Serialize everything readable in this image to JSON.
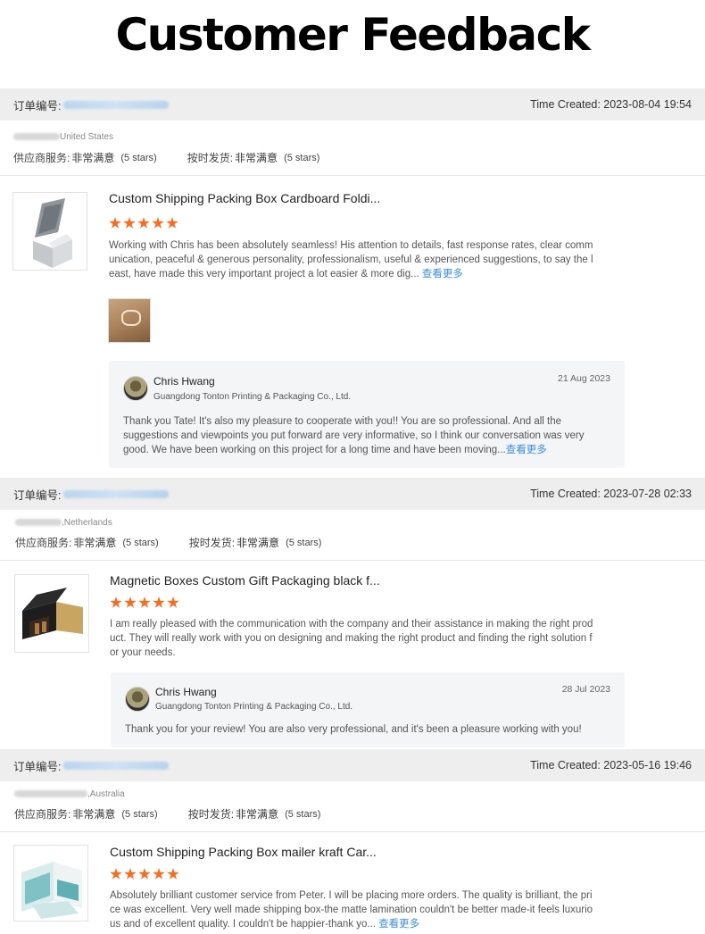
{
  "page": {
    "title": "Customer Feedback"
  },
  "labels": {
    "order_no": "订单编号:",
    "supplier_service": "供应商服务:",
    "shipping": "按时发货:",
    "very_satisfied": "非常满意",
    "five_stars": "(5 stars)",
    "see_more": "查看更多",
    "time_created_prefix": "Time Created: "
  },
  "reviews": [
    {
      "time_created": "Time Created: 2023-08-04 19:54",
      "country": "United States",
      "product_title": "Custom Shipping Packing Box Cardboard Foldi...",
      "rating": 5,
      "review_lines": [
        "Working with Chris has been absolutely seamless! His attention to details, fast response rates, clear comm",
        "unication, peaceful & generous personality, professionalism, useful & experienced suggestions, to say the l",
        "east, have made this very important project a lot easier & more dig..."
      ],
      "has_photo": true,
      "reply": {
        "name": "Chris Hwang",
        "company": "Guangdong Tonton Printing & Packaging Co., Ltd.",
        "date": "21 Aug 2023",
        "lines": [
          "Thank you Tate! It's also my pleasure to cooperate with you!! You are so professional. And all the",
          "suggestions and viewpoints you put forward are very informative, so I think our conversation was very",
          "good. We have been working on this project for a long time and have been moving..."
        ]
      }
    },
    {
      "time_created": "Time Created: 2023-07-28 02:33",
      "country": ",Netherlands",
      "product_title": "Magnetic Boxes Custom Gift Packaging black f...",
      "rating": 5,
      "review_lines": [
        "I am really pleased with the communication with the company and their assistance in making the right prod",
        "uct. They will really work with you on designing and making the right product and finding the right solution f",
        "or your needs."
      ],
      "reply": {
        "name": "Chris Hwang",
        "company": "Guangdong Tonton Printing & Packaging Co., Ltd.",
        "date": "28 Jul 2023",
        "lines": [
          "Thank you for your review! You are also very professional, and it's been a pleasure working with you!"
        ]
      }
    },
    {
      "time_created": "Time Created: 2023-05-16 19:46",
      "country": ",Australia",
      "product_title": "Custom Shipping Packing Box mailer kraft Car...",
      "rating": 5,
      "review_lines": [
        "Absolutely brilliant customer service from Peter. I will be placing more orders. The quality is brilliant, the pri",
        "ce was excellent. Very well made shipping box-the matte lamination couldn't be better made-it feels luxurio",
        "us and of excellent quality. I couldn't be happier-thank yo..."
      ]
    }
  ],
  "colors": {
    "star": "#ff6a1a",
    "link": "#3a8ee6",
    "bar_bg": "#eeeeee",
    "reply_bg": "#f4f5f7"
  }
}
